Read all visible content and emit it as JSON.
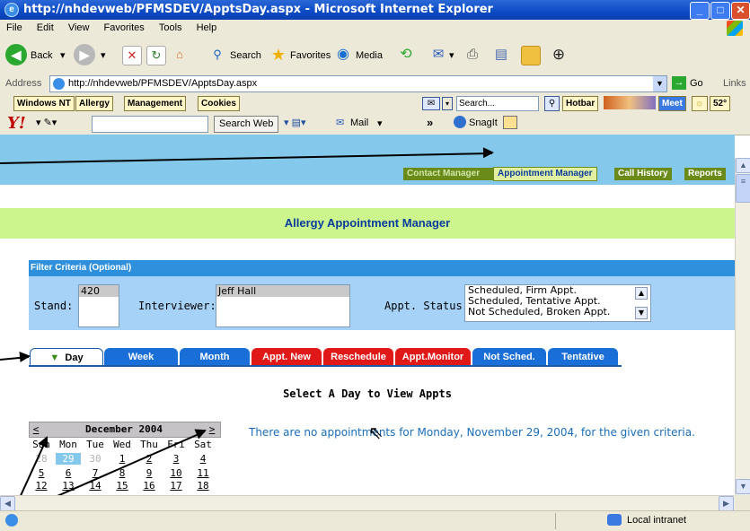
{
  "window": {
    "title": "http://nhdevweb/PFMSDEV/ApptsDay.aspx - Microsoft Internet Explorer",
    "min": "_",
    "max": "□",
    "close": "✕"
  },
  "menu": [
    "File",
    "Edit",
    "View",
    "Favorites",
    "Tools",
    "Help"
  ],
  "toolbar": {
    "back": "Back",
    "search": "Search",
    "favorites": "Favorites",
    "media": "Media"
  },
  "address": {
    "label": "Address",
    "url": "http://nhdevweb/PFMSDEV/ApptsDay.aspx",
    "go": "Go",
    "links": "Links"
  },
  "linksbar": {
    "windows_nt": "Windows NT",
    "allergy": "Allergy",
    "management": "Management",
    "cookies": "Cookies",
    "search_placeholder": "Search...",
    "hotbar": "Hotbar",
    "meet": "Meet",
    "temp": "52°"
  },
  "yahoo": {
    "logo": "Y!",
    "search_web": "Search Web",
    "mail": "Mail",
    "chevrons": "»",
    "snagit": "SnagIt"
  },
  "nav": {
    "contact": "Contact Manager",
    "appointment": "Appointment Manager",
    "call_history": "Call History",
    "reports": "Reports"
  },
  "banner": "Allergy Appointment Manager",
  "filter": {
    "header": "Filter Criteria (Optional)",
    "stand_label": "Stand:",
    "stand_value": "420",
    "interviewer_label": "Interviewer:",
    "interviewer_value": "Jeff Hall",
    "status_label": "Appt. Status:",
    "status_options": [
      "Scheduled, Firm Appt.",
      "Scheduled, Tentative Appt.",
      "Not Scheduled, Broken Appt."
    ]
  },
  "tabs": [
    {
      "label": "Day",
      "color": "#ffffff"
    },
    {
      "label": "Week",
      "color": "#1a6ed8"
    },
    {
      "label": "Month",
      "color": "#1a6ed8"
    },
    {
      "label": "Appt. New",
      "color": "#e01818"
    },
    {
      "label": "Reschedule",
      "color": "#e01818"
    },
    {
      "label": "Appt.Monitor",
      "color": "#e01818"
    },
    {
      "label": "Not Sched.",
      "color": "#1a6ed8"
    },
    {
      "label": "Tentative",
      "color": "#1a6ed8"
    }
  ],
  "main": {
    "select_day": "Select A Day to View Appts",
    "message": "There are no appointments for Monday, November 29, 2004, for the given criteria."
  },
  "calendar": {
    "prev": "<",
    "next": ">",
    "month": "December 2004",
    "weekdays": [
      "Sun",
      "Mon",
      "Tue",
      "Wed",
      "Thu",
      "Fri",
      "Sat"
    ],
    "rows": [
      [
        "28",
        "29",
        "30",
        "1",
        "2",
        "3",
        "4"
      ],
      [
        "5",
        "6",
        "7",
        "8",
        "9",
        "10",
        "11"
      ],
      [
        "12",
        "13",
        "14",
        "15",
        "16",
        "17",
        "18"
      ]
    ]
  },
  "status": {
    "zone": "Local intranet"
  },
  "colors": {
    "accent_blue": "#2e8fdc",
    "banner_green": "#cdf58e",
    "nav_olive": "#6a8a1a",
    "red_tab": "#e01818"
  }
}
